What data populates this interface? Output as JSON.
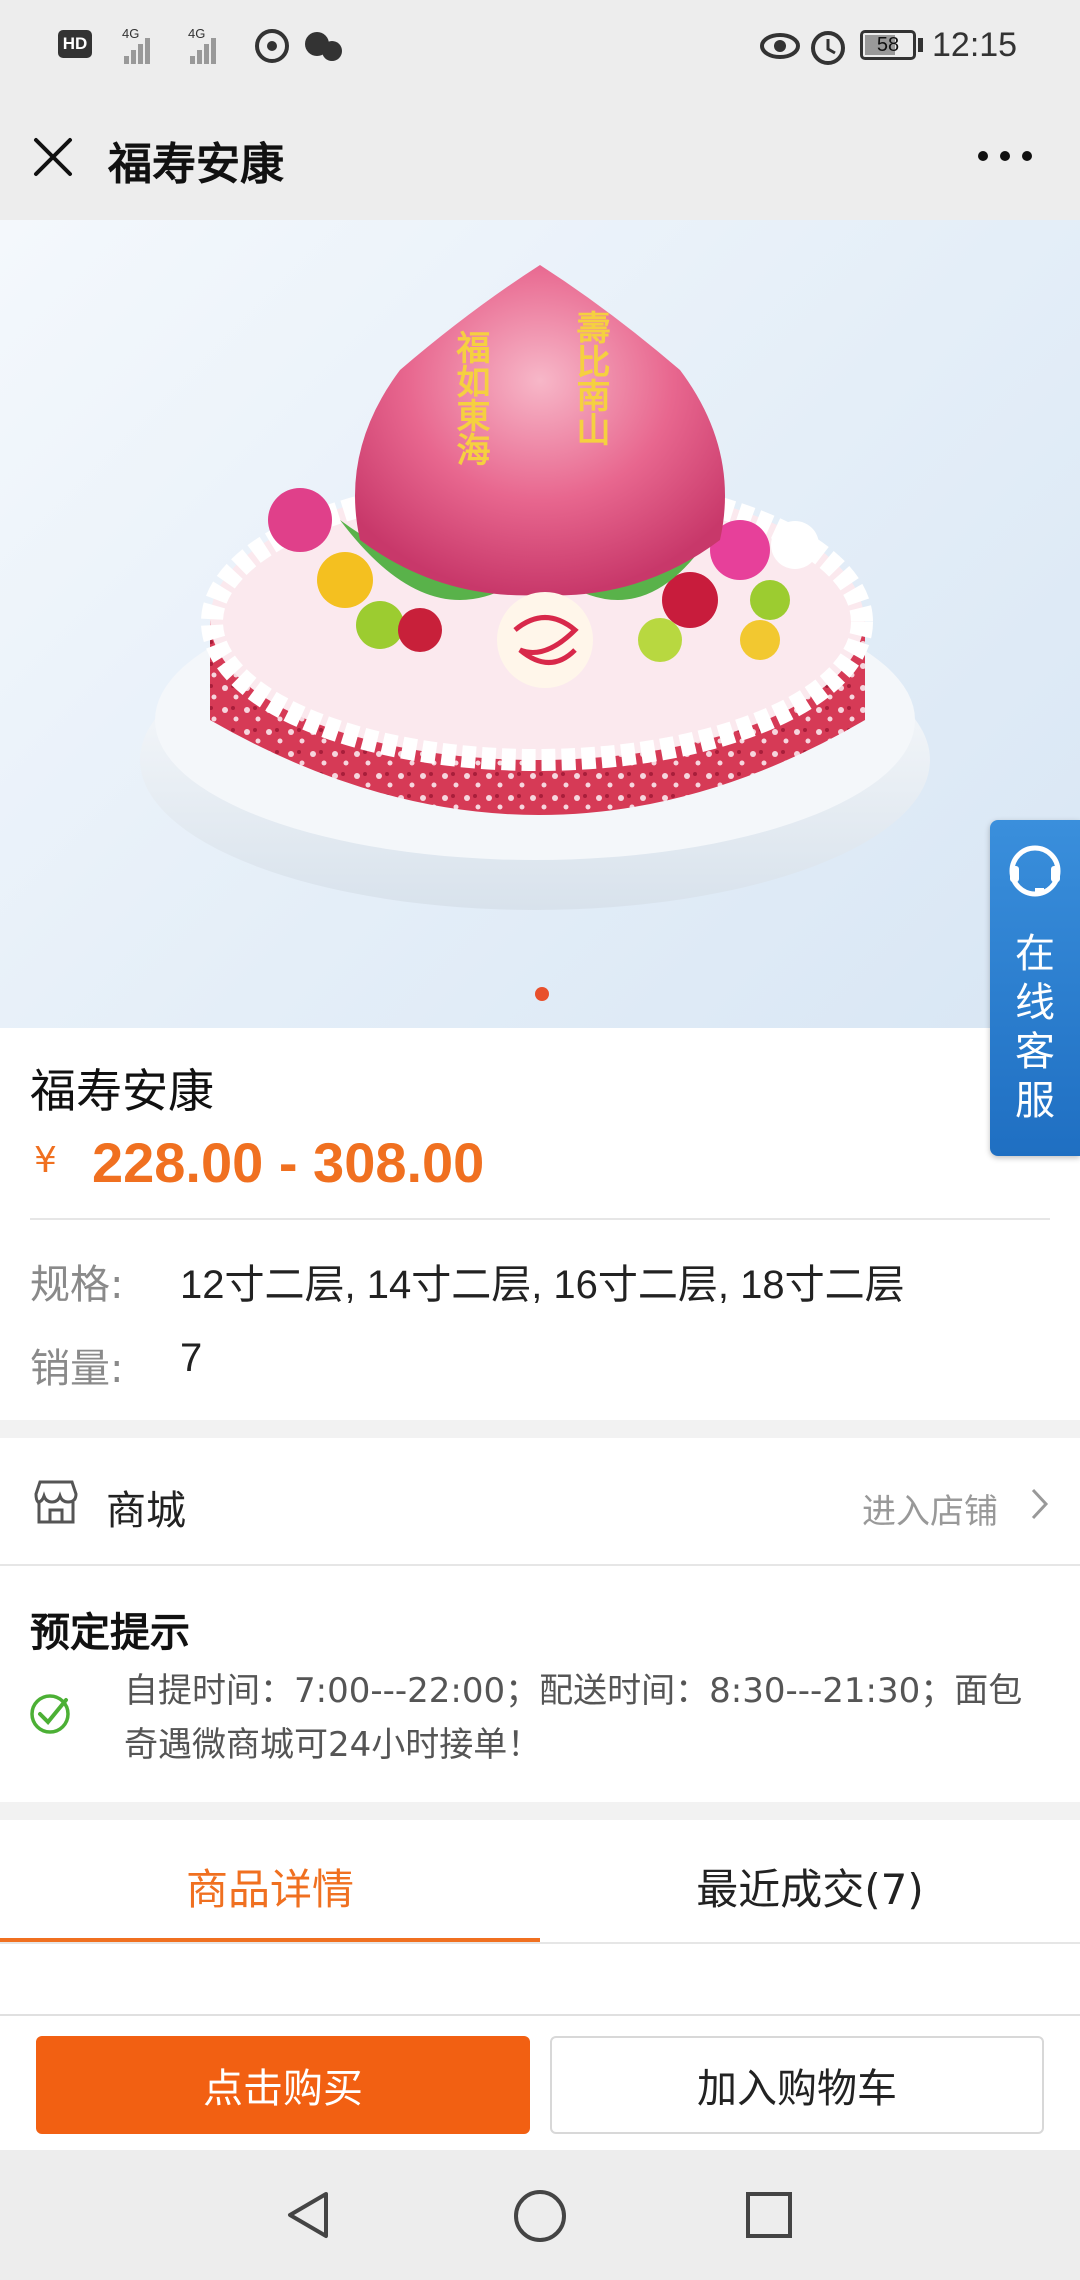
{
  "status_bar": {
    "battery": "58",
    "time": "12:15",
    "network": "4G"
  },
  "header": {
    "title": "福寿安康",
    "close_icon": "close-icon",
    "more_icon": "more-icon"
  },
  "hero": {
    "peach_text_left": "福如東海",
    "peach_text_right": "壽比南山"
  },
  "service_float": {
    "label": "在线客服"
  },
  "product": {
    "name": "福寿安康",
    "currency": "¥",
    "price": "228.00 - 308.00",
    "spec_label": "规格:",
    "spec_value": "12寸二层, 14寸二层, 16寸二层, 18寸二层",
    "sales_label": "销量:",
    "sales_value": "7"
  },
  "store": {
    "label": "商城",
    "enter": "进入店铺"
  },
  "notice": {
    "title": "预定提示",
    "text": "自提时间：7:00---22:00；配送时间：8:30---21:30；面包奇遇微商城可24小时接单！"
  },
  "tabs": {
    "detail": "商品详情",
    "recent": "最近成交(7)"
  },
  "actions": {
    "buy": "点击购买",
    "add_cart": "加入购物车"
  },
  "colors": {
    "accent": "#f07020",
    "buy_button": "#f26012",
    "service": "#1f6fc2"
  }
}
